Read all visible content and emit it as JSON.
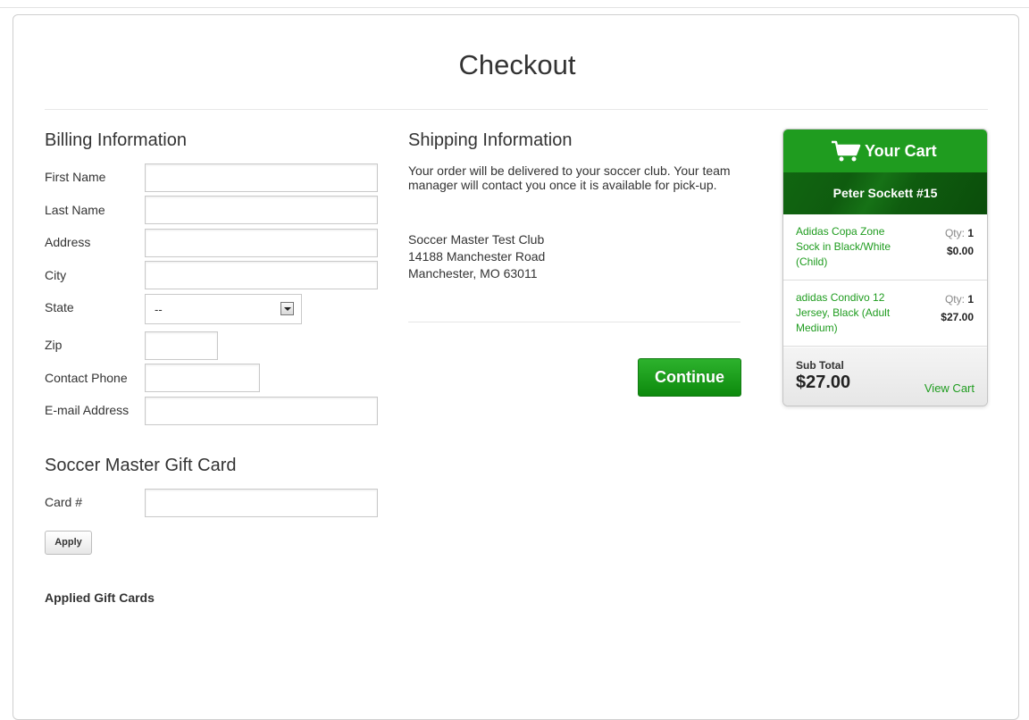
{
  "page": {
    "title": "Checkout"
  },
  "billing": {
    "heading": "Billing Information",
    "fields": {
      "first_name": {
        "label": "First Name",
        "value": ""
      },
      "last_name": {
        "label": "Last Name",
        "value": ""
      },
      "address": {
        "label": "Address",
        "value": ""
      },
      "city": {
        "label": "City",
        "value": ""
      },
      "state": {
        "label": "State",
        "value": "--"
      },
      "zip": {
        "label": "Zip",
        "value": ""
      },
      "contact_phone": {
        "label": "Contact Phone",
        "value": ""
      },
      "email": {
        "label": "E-mail Address",
        "value": ""
      }
    }
  },
  "gift_card": {
    "heading": "Soccer Master Gift Card",
    "card_label": "Card #",
    "card_value": "",
    "apply_label": "Apply",
    "applied_heading": "Applied Gift Cards"
  },
  "shipping": {
    "heading": "Shipping Information",
    "note": "Your order will be delivered to your soccer club. Your team manager will contact you once it is available for pick-up.",
    "address_line1": "Soccer Master Test Club",
    "address_line2": "14188 Manchester Road",
    "address_line3": "Manchester, MO 63011",
    "continue_label": "Continue"
  },
  "cart": {
    "title": "Your Cart",
    "icon": "shopping-cart-icon",
    "player": "Peter Sockett #15",
    "qty_label": "Qty:",
    "items": [
      {
        "name": "Adidas Copa Zone Sock in Black/White (Child)",
        "qty": "1",
        "price": "$0.00"
      },
      {
        "name": "adidas Condivo 12 Jersey, Black (Adult Medium)",
        "qty": "1",
        "price": "$27.00"
      }
    ],
    "subtotal_label": "Sub Total",
    "subtotal_value": "$27.00",
    "view_cart_label": "View Cart"
  },
  "colors": {
    "accent": "#1f9c1f",
    "accent_dark": "#0f5c0f"
  }
}
